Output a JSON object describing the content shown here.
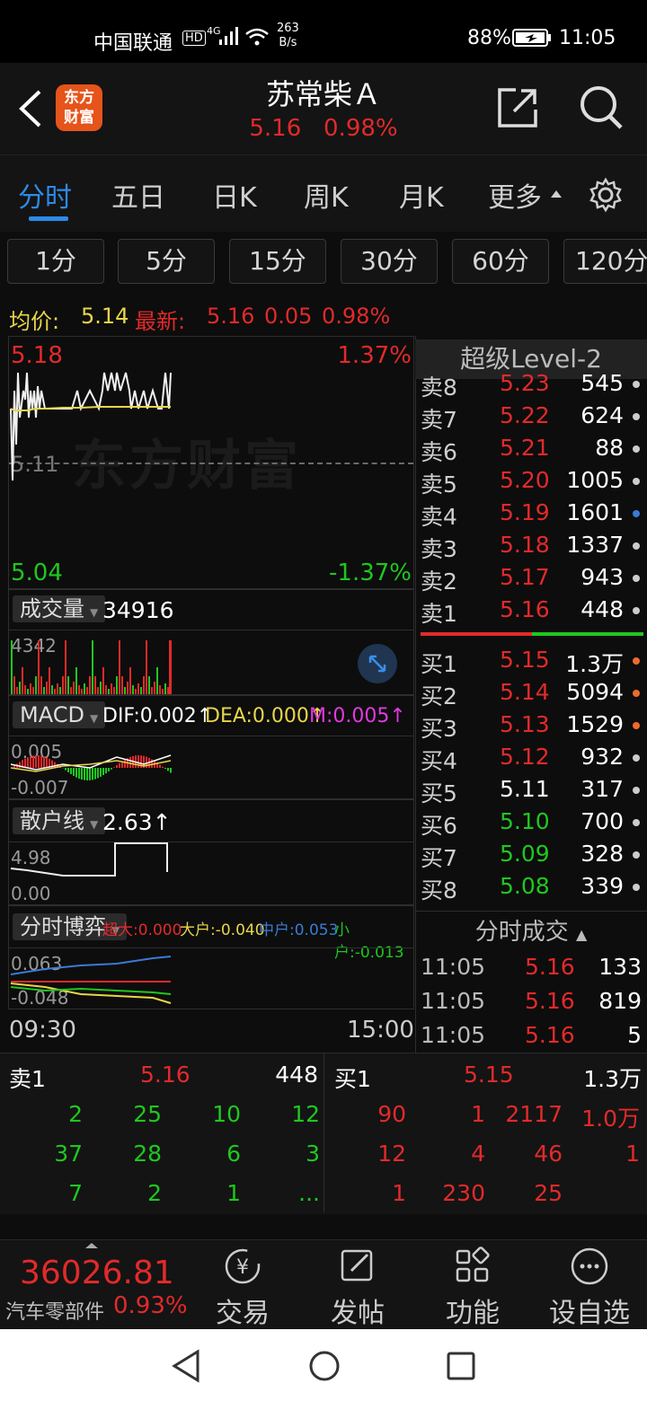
{
  "status": {
    "carrier": "中国联通",
    "speed_num": "263",
    "speed_unit": "B/s",
    "battery": "88%",
    "time": "11:05",
    "hd": "HD",
    "network": "4G"
  },
  "header": {
    "logo_line1": "东方",
    "logo_line2": "财富",
    "stock_name": "苏常柴Ａ",
    "price": "5.16",
    "change_pct": "0.98%"
  },
  "tabs": [
    {
      "label": "分时"
    },
    {
      "label": "五日"
    },
    {
      "label": "日K"
    },
    {
      "label": "周K"
    },
    {
      "label": "月K"
    },
    {
      "label": "更多"
    }
  ],
  "periods": [
    "1分",
    "5分",
    "15分",
    "30分",
    "60分",
    "120分"
  ],
  "avg": {
    "avg_label": "均价:",
    "avg_value": "5.14",
    "latest_label": "最新:",
    "latest_price": "5.16",
    "latest_chg": "0.05",
    "latest_pct": "0.98%"
  },
  "price_chart": {
    "high": "5.18",
    "high_pct": "1.37%",
    "mid": "5.11",
    "low": "5.04",
    "low_pct": "-1.37%",
    "watermark": "东方财富",
    "start_time": "09:30",
    "end_time": "15:00"
  },
  "volume": {
    "label": "成交量",
    "value": "34916",
    "max": "4342"
  },
  "macd": {
    "label": "MACD",
    "dif": "DIF:0.002↑",
    "dea": "DEA:0.000↑",
    "m": "M:0.005↑",
    "top": "0.005",
    "bottom": "-0.007"
  },
  "retail": {
    "label": "散户线",
    "value": "2.63↑",
    "top": "4.98",
    "bottom": "0.00"
  },
  "game": {
    "label": "分时博弈",
    "super": "超大:0.000",
    "big": "大户:-0.040",
    "mid": "中户:0.053",
    "small": "小户:-0.013",
    "top": "0.063",
    "bottom": "-0.048"
  },
  "level2": {
    "title": "超级Level-2"
  },
  "asks": [
    {
      "name": "卖8",
      "price": "5.23",
      "vol": "545",
      "dot": "#cccccc"
    },
    {
      "name": "卖7",
      "price": "5.22",
      "vol": "624",
      "dot": "#cccccc"
    },
    {
      "name": "卖6",
      "price": "5.21",
      "vol": "88",
      "dot": "#cccccc"
    },
    {
      "name": "卖5",
      "price": "5.20",
      "vol": "1005",
      "dot": "#cccccc"
    },
    {
      "name": "卖4",
      "price": "5.19",
      "vol": "1601",
      "dot": "#3a7bd5"
    },
    {
      "name": "卖3",
      "price": "5.18",
      "vol": "1337",
      "dot": "#cccccc"
    },
    {
      "name": "卖2",
      "price": "5.17",
      "vol": "943",
      "dot": "#cccccc"
    },
    {
      "name": "卖1",
      "price": "5.16",
      "vol": "448",
      "dot": "#cccccc"
    }
  ],
  "bids": [
    {
      "name": "买1",
      "price": "5.15",
      "vol": "1.3万",
      "dot": "#ef6a2a",
      "pc": "red"
    },
    {
      "name": "买2",
      "price": "5.14",
      "vol": "5094",
      "dot": "#ef6a2a",
      "pc": "red"
    },
    {
      "name": "买3",
      "price": "5.13",
      "vol": "1529",
      "dot": "#ef6a2a",
      "pc": "red"
    },
    {
      "name": "买4",
      "price": "5.12",
      "vol": "932",
      "dot": "#cccccc",
      "pc": "red"
    },
    {
      "name": "买5",
      "price": "5.11",
      "vol": "317",
      "dot": "#cccccc",
      "pc": "white"
    },
    {
      "name": "买6",
      "price": "5.10",
      "vol": "700",
      "dot": "#cccccc",
      "pc": "green"
    },
    {
      "name": "买7",
      "price": "5.09",
      "vol": "328",
      "dot": "#cccccc",
      "pc": "green"
    },
    {
      "name": "买8",
      "price": "5.08",
      "vol": "339",
      "dot": "#cccccc",
      "pc": "green"
    }
  ],
  "trades": {
    "title": "分时成交",
    "rows": [
      {
        "time": "11:05",
        "price": "5.16",
        "vol": "133"
      },
      {
        "time": "11:05",
        "price": "5.16",
        "vol": "819"
      },
      {
        "time": "11:05",
        "price": "5.16",
        "vol": "5"
      }
    ]
  },
  "queue": {
    "sell_label": "卖1",
    "sell_price": "5.16",
    "sell_vol": "448",
    "buy_label": "买1",
    "buy_price": "5.15",
    "buy_vol": "1.3万",
    "sell_rows": [
      [
        "2",
        "25",
        "10",
        "12"
      ],
      [
        "37",
        "28",
        "6",
        "3"
      ],
      [
        "7",
        "2",
        "1",
        "..."
      ]
    ],
    "buy_rows": [
      [
        "90",
        "1",
        "2117",
        "1.0万"
      ],
      [
        "12",
        "4",
        "46",
        "1"
      ],
      [
        "1",
        "230",
        "25",
        ""
      ]
    ]
  },
  "bottom_nav": {
    "index_value": "36026.81",
    "index_name": "汽车零部件",
    "index_pct": "0.93%",
    "trade": "交易",
    "post": "发帖",
    "func": "功能",
    "watch": "设自选"
  }
}
